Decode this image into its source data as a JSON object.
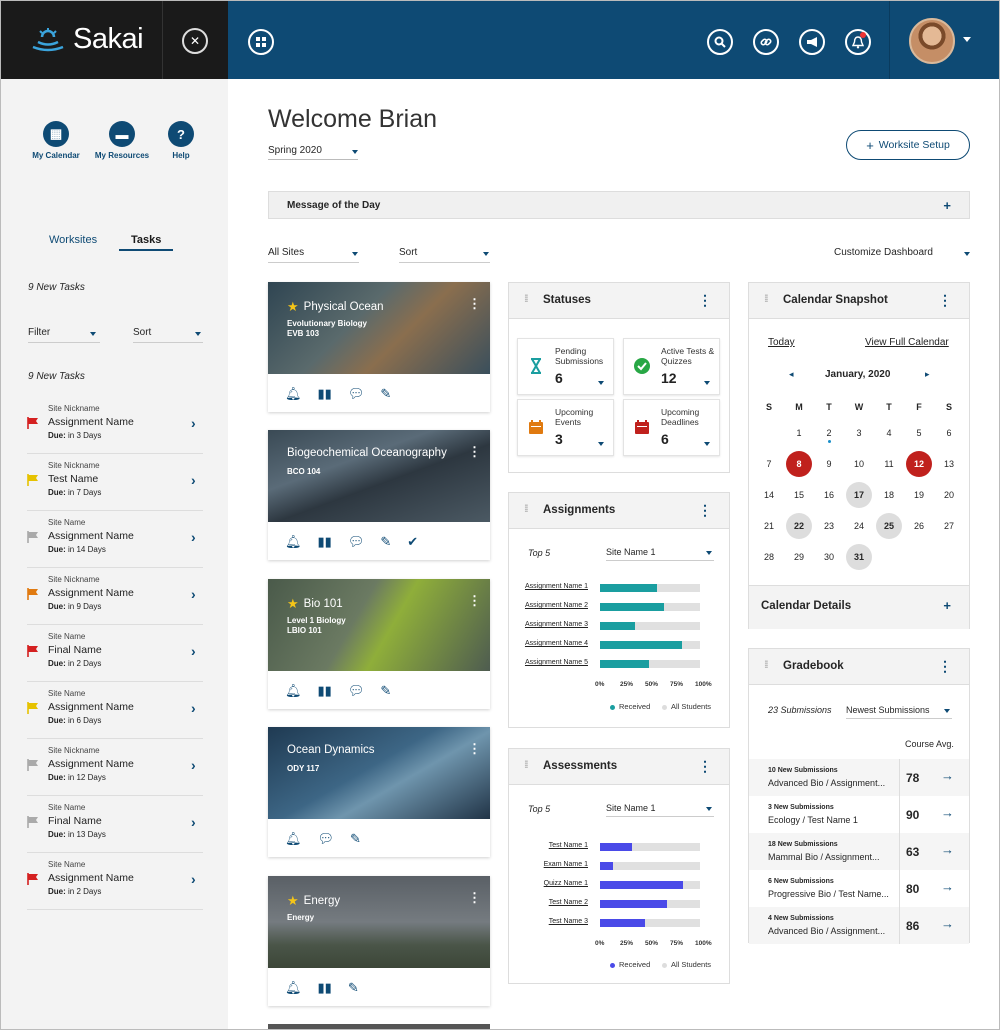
{
  "header": {
    "logo_text": "Sakai",
    "colors": {
      "brand_bg": "#1a1a1a",
      "topbar": "#0e4a74",
      "accent": "#0e4a74"
    },
    "icons": [
      "close-icon",
      "apps-grid-icon",
      "search-icon",
      "link-icon",
      "megaphone-icon",
      "bell-icon"
    ]
  },
  "sidebar": {
    "quick_links": [
      {
        "label": "My Calendar",
        "icon": "calendar-icon"
      },
      {
        "label": "My Resources",
        "icon": "folder-icon"
      },
      {
        "label": "Help",
        "icon": "help-icon"
      }
    ],
    "tabs": [
      "Worksites",
      "Tasks"
    ],
    "active_tab": "Tasks",
    "new_tasks_top": "9 New Tasks",
    "filter_label": "Filter",
    "sort_label": "Sort",
    "new_tasks_list": "9 New Tasks",
    "tasks": [
      {
        "site": "Site Nickname",
        "name": "Assignment Name",
        "due_label": "Due:",
        "due": "in 3 Days",
        "flag": "#d42020"
      },
      {
        "site": "Site Nickname",
        "name": "Test Name",
        "due_label": "Due:",
        "due": "in 7 Days",
        "flag": "#e6c200"
      },
      {
        "site": "Site Name",
        "name": "Assignment Name",
        "due_label": "Due:",
        "due": "in 14 Days",
        "flag": "#aaaaaa"
      },
      {
        "site": "Site Nickname",
        "name": "Assignment Name",
        "due_label": "Due:",
        "due": "in 9 Days",
        "flag": "#e07a10"
      },
      {
        "site": "Site Name",
        "name": "Final Name",
        "due_label": "Due:",
        "due": "in 2 Days",
        "flag": "#d42020"
      },
      {
        "site": "Site Name",
        "name": "Assignment Name",
        "due_label": "Due:",
        "due": "in 6 Days",
        "flag": "#e6c200"
      },
      {
        "site": "Site Nickname",
        "name": "Assignment Name",
        "due_label": "Due:",
        "due": "in 12 Days",
        "flag": "#aaaaaa"
      },
      {
        "site": "Site Name",
        "name": "Final Name",
        "due_label": "Due:",
        "due": "in 13 Days",
        "flag": "#aaaaaa"
      },
      {
        "site": "Site Name",
        "name": "Assignment Name",
        "due_label": "Due:",
        "due": "in 2 Days",
        "flag": "#d42020"
      }
    ]
  },
  "main": {
    "welcome": "Welcome Brian",
    "term": "Spring 2020",
    "worksite_setup": "Worksite Setup",
    "motd": "Message of the Day",
    "all_sites": "All Sites",
    "sort": "Sort",
    "customize": "Customize Dashboard"
  },
  "sites": [
    {
      "title": "Physical Ocean",
      "sub1": "Evolutionary Biology",
      "sub2": "EVB 103",
      "starred": true
    },
    {
      "title": "Biogeochemical Oceanography",
      "sub1": "BCO 104",
      "sub2": "",
      "starred": false
    },
    {
      "title": "Bio 101",
      "sub1": "Level 1 Biology",
      "sub2": "LBIO 101",
      "starred": true
    },
    {
      "title": "Ocean Dynamics",
      "sub1": "ODY 117",
      "sub2": "",
      "starred": false
    },
    {
      "title": "Energy",
      "sub1": "Energy",
      "sub2": "",
      "starred": true
    }
  ],
  "statuses": {
    "title": "Statuses",
    "items": [
      {
        "label": "Pending Submissions",
        "value": "6",
        "icon": "hourglass-icon",
        "color": "#1a9ea0"
      },
      {
        "label": "Active Tests & Quizzes",
        "value": "12",
        "icon": "verified-check-icon",
        "color": "#28a745"
      },
      {
        "label": "Upcoming Events",
        "value": "3",
        "icon": "calendar-icon",
        "color": "#e07a10"
      },
      {
        "label": "Upcoming Deadlines",
        "value": "6",
        "icon": "calendar-icon",
        "color": "#c0211d"
      }
    ]
  },
  "assignments": {
    "title": "Assignments",
    "top": "Top 5",
    "site": "Site Name 1",
    "legend_received": "Received",
    "legend_all": "All Students",
    "color": "#1a9ea0"
  },
  "assessments": {
    "title": "Assessments",
    "top": "Top 5",
    "site": "Site Name 1",
    "legend_received": "Received",
    "legend_all": "All Students",
    "color": "#4a4ae8"
  },
  "chart_data": [
    {
      "type": "bar",
      "orientation": "horizontal",
      "categories": [
        "Assignment Name 1",
        "Assignment Name 2",
        "Assignment Name 3",
        "Assignment Name 4",
        "Assignment Name 5"
      ],
      "series": [
        {
          "name": "Received",
          "values": [
            57,
            64,
            35,
            82,
            49
          ]
        },
        {
          "name": "All Students",
          "values": [
            100,
            100,
            100,
            100,
            100
          ]
        }
      ],
      "xticks": [
        "0%",
        "25%",
        "50%",
        "75%",
        "100%"
      ],
      "xlim": [
        0,
        100
      ],
      "legend": "bottom"
    },
    {
      "type": "bar",
      "orientation": "horizontal",
      "categories": [
        "Test Name 1",
        "Exam Name 1",
        "Quizz Name 1",
        "Test Name 2",
        "Test Name 3"
      ],
      "series": [
        {
          "name": "Received",
          "values": [
            32,
            13,
            83,
            67,
            45
          ]
        },
        {
          "name": "All Students",
          "values": [
            100,
            100,
            100,
            100,
            100
          ]
        }
      ],
      "xticks": [
        "0%",
        "25%",
        "50%",
        "75%",
        "100%"
      ],
      "xlim": [
        0,
        100
      ],
      "legend": "bottom"
    }
  ],
  "calendar": {
    "title": "Calendar Snapshot",
    "today": "Today",
    "view_full": "View Full Calendar",
    "month": "January, 2020",
    "weekdays": [
      "S",
      "M",
      "T",
      "W",
      "T",
      "F",
      "S"
    ],
    "days": [
      [
        "",
        "",
        "",
        "",
        "",
        "",
        ""
      ],
      [
        "",
        "1",
        "2",
        "3",
        "4",
        "5",
        "6"
      ],
      [
        "7",
        "8",
        "9",
        "10",
        "11",
        "12",
        "13"
      ],
      [
        "14",
        "15",
        "16",
        "17",
        "18",
        "19",
        "20"
      ],
      [
        "21",
        "22",
        "23",
        "24",
        "25",
        "26",
        "27"
      ],
      [
        "28",
        "29",
        "30",
        "31",
        "",
        "",
        ""
      ]
    ],
    "red_days": [
      "8",
      "12"
    ],
    "gray_days": [
      "17",
      "22",
      "25",
      "31"
    ],
    "event_days": [
      "2"
    ],
    "details": "Calendar Details"
  },
  "gradebook": {
    "title": "Gradebook",
    "count": "23 Submissions",
    "sort": "Newest Submissions",
    "col": "Course Avg.",
    "rows": [
      {
        "sub": "10 New Submissions",
        "name": "Advanced Bio / Assignment...",
        "avg": "78"
      },
      {
        "sub": "3 New Submissions",
        "name": "Ecology / Test Name 1",
        "avg": "90"
      },
      {
        "sub": "18 New Submissions",
        "name": "Mammal Bio / Assignment...",
        "avg": "63"
      },
      {
        "sub": "6 New Submissions",
        "name": "Progressive Bio / Test Name...",
        "avg": "80"
      },
      {
        "sub": "4 New Submissions",
        "name": "Advanced Bio / Assignment...",
        "avg": "86"
      }
    ]
  }
}
